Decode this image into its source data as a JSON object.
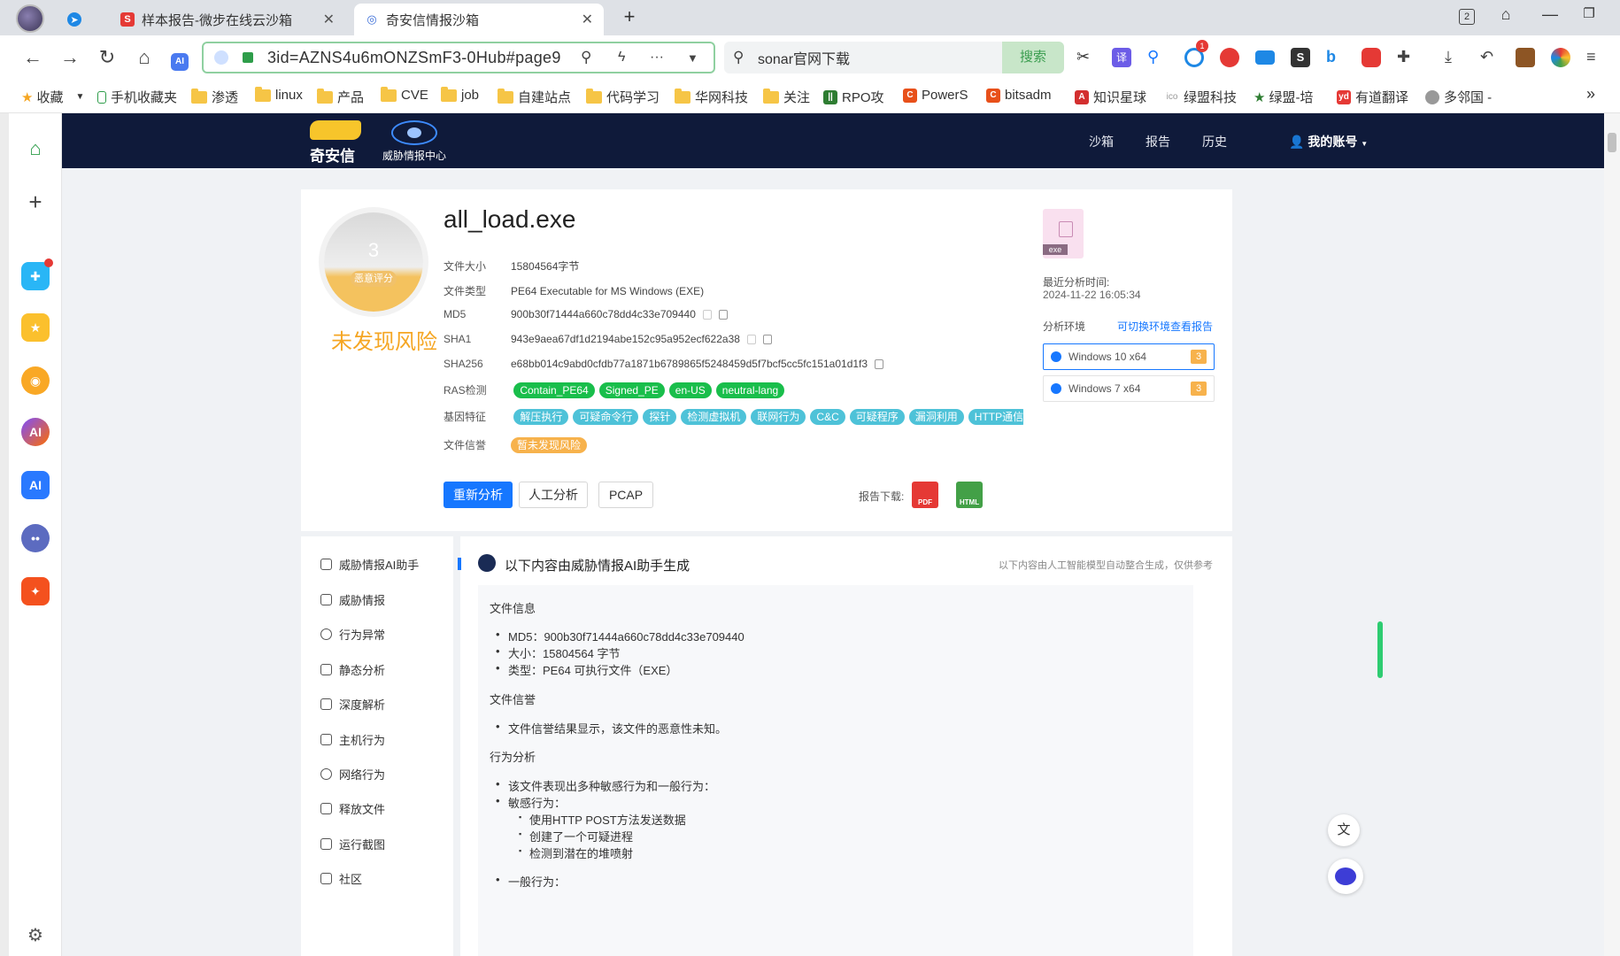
{
  "browser": {
    "tabs": [
      {
        "label": "样本报告-微步在线云沙箱",
        "active": false
      },
      {
        "label": "奇安信情报沙箱",
        "active": true
      }
    ],
    "new_tab": "+",
    "tab_count": "2",
    "url": "3id=AZNS4u6mONZSmF3-0Hub#page9",
    "search_text": "sonar官网下载",
    "search_button": "搜索",
    "ext_badge": "1",
    "bookmarks": [
      "收藏",
      "手机收藏夹",
      "渗透",
      "linux",
      "产品",
      "CVE",
      "job",
      "自建站点",
      "代码学习",
      "华网科技",
      "关注",
      "RPO攻",
      "PowerS",
      "bitsadm",
      "知识星球",
      "绿盟科技",
      "绿盟-培",
      "有道翻译",
      "多邻国 -"
    ],
    "more": "»"
  },
  "site": {
    "logo_text": "奇安信",
    "logo_sub": "威胁情报中心",
    "nav": [
      "沙箱",
      "报告",
      "历史"
    ],
    "account": "我的账号"
  },
  "summary": {
    "score": "3",
    "score_label": "恶意评分",
    "risk_text": "未发现风险",
    "filename": "all_load.exe",
    "fields": [
      {
        "k": "文件大小",
        "v": "15804564字节"
      },
      {
        "k": "文件类型",
        "v": "PE64 Executable for MS Windows (EXE)"
      },
      {
        "k": "MD5",
        "v": "900b30f71444a660c78dd4c33e709440"
      },
      {
        "k": "SHA1",
        "v": "943e9aea67df1d2194abe152c95a952ecf622a38"
      },
      {
        "k": "SHA256",
        "v": "e68bb014c9abd0cfdb77a1871b6789865f5248459d5f7bcf5cc5fc151a01d1f3"
      }
    ],
    "ras_label": "RAS检测",
    "ras_tags": [
      "Contain_PE64",
      "Signed_PE",
      "en-US",
      "neutral-lang"
    ],
    "gene_label": "基因特征",
    "gene_tags": [
      "解压执行",
      "可疑命令行",
      "探针",
      "检测虚拟机",
      "联网行为",
      "C&C",
      "可疑程序",
      "漏洞利用",
      "HTTP通信"
    ],
    "rep_label": "文件信誉",
    "rep_tag": "暂未发现风险",
    "buttons": {
      "reanalyze": "重新分析",
      "manual": "人工分析",
      "pcap": "PCAP"
    },
    "download_label": "报告下载:",
    "pdf": "PDF",
    "html": "HTML"
  },
  "side_panel": {
    "file_ext": "exe",
    "last_time_label": "最近分析时间:",
    "last_time": "2024-11-22 16:05:34",
    "env_label": "分析环境",
    "env_link": "可切换环境查看报告",
    "envs": [
      {
        "name": "Windows 10 x64",
        "count": "3"
      },
      {
        "name": "Windows 7 x64",
        "count": "3"
      }
    ]
  },
  "left_menu": [
    "威胁情报AI助手",
    "威胁情报",
    "行为异常",
    "静态分析",
    "深度解析",
    "主机行为",
    "网络行为",
    "释放文件",
    "运行截图",
    "社区"
  ],
  "ai": {
    "title": "以下内容由威胁情报AI助手生成",
    "note": "以下内容由人工智能模型自动整合生成，仅供参考",
    "sec1": "文件信息",
    "sec1_items": [
      "MD5：900b30f71444a660c78dd4c33e709440",
      "大小：15804564 字节",
      "类型：PE64 可执行文件（EXE）"
    ],
    "sec2": "文件信誉",
    "sec2_items": [
      "文件信誉结果显示，该文件的恶意性未知。"
    ],
    "sec3": "行为分析",
    "sec3_items": [
      "该文件表现出多种敏感行为和一般行为：",
      "敏感行为："
    ],
    "sec3_sub": [
      "使用HTTP POST方法发送数据",
      "创建了一个可疑进程",
      "检测到潜在的堆喷射"
    ],
    "sec3_more": "一般行为："
  },
  "colors": {
    "primary": "#1677ff",
    "nav_bg": "#0f1a3a",
    "risk": "#f5a623",
    "tag_green": "#19be4b",
    "tag_teal": "#4ec2d8"
  }
}
